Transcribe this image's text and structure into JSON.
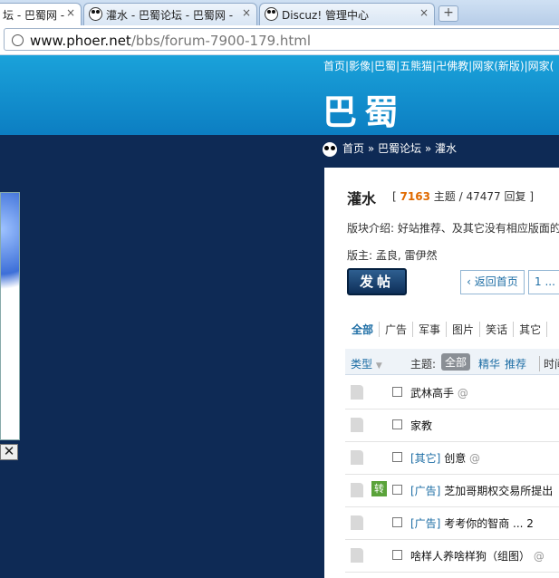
{
  "browser": {
    "tabs": [
      {
        "title": "坛 - 巴蜀网 -",
        "active": true
      },
      {
        "title": "灌水 - 巴蜀论坛 - 巴蜀网 -",
        "active": false
      },
      {
        "title": "Discuz! 管理中心",
        "active": false
      }
    ],
    "close_glyph": "×",
    "new_tab_glyph": "+",
    "url_host": "www.phoer.net",
    "url_path": "/bbs/forum-7900-179.html"
  },
  "header": {
    "top_nav": "首页|影像|巴蜀|五熊猫|卍佛教|网家(新版)|网家(",
    "logo": "巴蜀"
  },
  "breadcrumb": {
    "home": "首页",
    "forum": "巴蜀论坛",
    "current": "灌水",
    "sep": "»"
  },
  "left_panel": {
    "close_glyph": "✕"
  },
  "forum": {
    "title": "灌水",
    "stats_open": "[",
    "topic_count": "7163",
    "topic_label": "主题",
    "slash": "/",
    "reply_count": "47477",
    "reply_label": "回复",
    "stats_close": "]",
    "intro": "版块介绍: 好站推荐、及其它没有相应版面的",
    "moderators": "版主: 孟良, 雷伊然",
    "post_button": "发帖",
    "home_button": "返回首页",
    "page_button": "1 ..."
  },
  "category_tabs": [
    "全部",
    "广告",
    "军事",
    "图片",
    "笑话",
    "其它"
  ],
  "filter": {
    "type": "类型",
    "topic": "主题:",
    "all": "全部",
    "digest": "精华",
    "recommend": "推荐",
    "time": "时间"
  },
  "threads": [
    {
      "category": "",
      "title": "武林高手",
      "suffix": "",
      "attachment": true,
      "badge": ""
    },
    {
      "category": "",
      "title": "家教",
      "suffix": "",
      "attachment": false,
      "badge": ""
    },
    {
      "category": "[其它]",
      "title": "创意",
      "suffix": "",
      "attachment": true,
      "badge": ""
    },
    {
      "category": "[广告]",
      "title": "芝加哥期权交易所提出",
      "suffix": "",
      "attachment": false,
      "badge": "转"
    },
    {
      "category": "[广告]",
      "title": "考考你的智商",
      "suffix": "... 2",
      "attachment": false,
      "badge": ""
    },
    {
      "category": "",
      "title": "啥样人养啥样狗（组图）",
      "suffix": "",
      "attachment": true,
      "badge": ""
    }
  ],
  "attachment_glyph": "@",
  "colors": {
    "banner": "#1aa2da",
    "page_bg": "#0e2a55",
    "accent": "#e06a00",
    "link": "#1e6ea5"
  }
}
